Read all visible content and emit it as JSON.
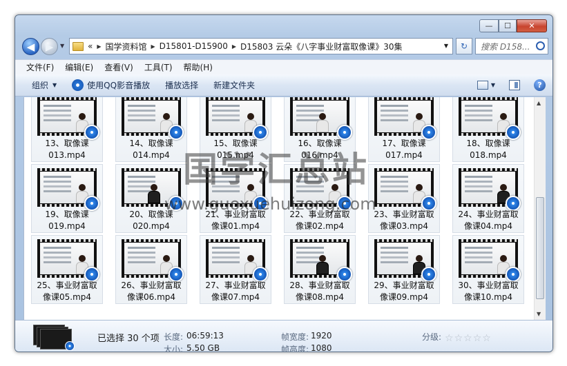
{
  "window": {
    "minimize": "—",
    "maximize": "☐",
    "close": "✕"
  },
  "nav": {
    "back": "◀",
    "forward": "▶"
  },
  "address": {
    "overflow": "«",
    "crumbs": [
      "国学资料馆",
      "D15801-D15900",
      "D15803 云朵《八字事业财富取像课》30集"
    ]
  },
  "search": {
    "placeholder": "搜索 D158..."
  },
  "menu": [
    "文件(F)",
    "编辑(E)",
    "查看(V)",
    "工具(T)",
    "帮助(H)"
  ],
  "toolbar": {
    "organize": "组织",
    "play_qq": "使用QQ影音播放",
    "play_select": "播放选择",
    "new_folder": "新建文件夹",
    "help": "?"
  },
  "files": [
    {
      "line1": "13、取像课",
      "line2": "013.mp4"
    },
    {
      "line1": "14、取像课",
      "line2": "014.mp4"
    },
    {
      "line1": "15、取像课",
      "line2": "015.mp4"
    },
    {
      "line1": "16、取像课",
      "line2": "016.mp4"
    },
    {
      "line1": "17、取像课",
      "line2": "017.mp4"
    },
    {
      "line1": "18、取像课",
      "line2": "018.mp4"
    },
    {
      "line1": "19、取像课",
      "line2": "019.mp4"
    },
    {
      "line1": "20、取像课",
      "line2": "020.mp4"
    },
    {
      "line1": "21、事业财富取",
      "line2": "像课01.mp4"
    },
    {
      "line1": "22、事业财富取",
      "line2": "像课02.mp4"
    },
    {
      "line1": "23、事业财富取",
      "line2": "像课03.mp4"
    },
    {
      "line1": "24、事业财富取",
      "line2": "像课04.mp4"
    },
    {
      "line1": "25、事业财富取",
      "line2": "像课05.mp4"
    },
    {
      "line1": "26、事业财富取",
      "line2": "像课06.mp4"
    },
    {
      "line1": "27、事业财富取",
      "line2": "像课07.mp4"
    },
    {
      "line1": "28、事业财富取",
      "line2": "像课08.mp4"
    },
    {
      "line1": "29、事业财富取",
      "line2": "像课09.mp4"
    },
    {
      "line1": "30、事业财富取",
      "line2": "像课10.mp4"
    }
  ],
  "details": {
    "selected": "已选择 30 个项",
    "length_label": "长度:",
    "length": "06:59:13",
    "size_label": "大小:",
    "size": "5.50 GB",
    "width_label": "帧宽度:",
    "width": "1920",
    "height_label": "帧高度:",
    "height": "1080",
    "rating_label": "分级:",
    "rating": 0
  },
  "watermark": {
    "title": "国学汇总站",
    "url": "www.guoxuehuizong.com"
  }
}
